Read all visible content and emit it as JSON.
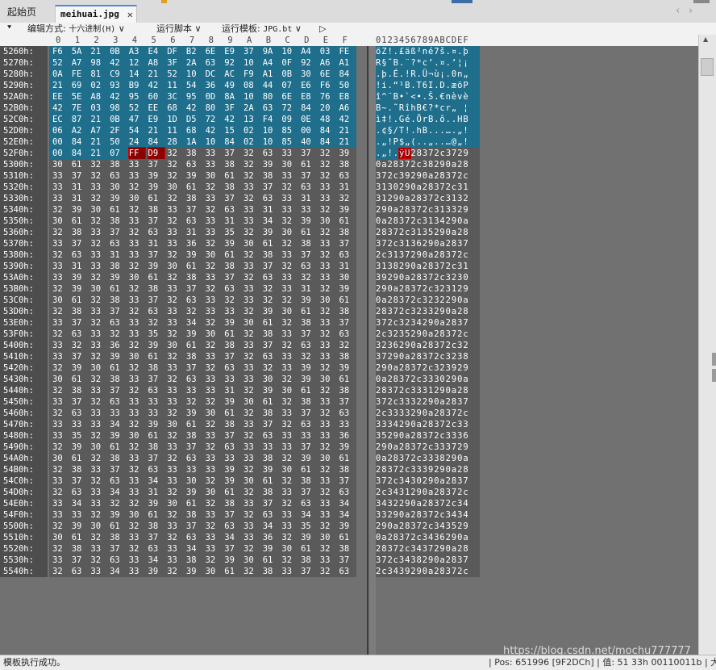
{
  "tabs": {
    "home_label": "起始页",
    "file_label": "meihuai.jpg",
    "close": "✕",
    "nav_left": "‹",
    "nav_right": "›"
  },
  "toolbar": {
    "arrow": "⯆",
    "edit_mode_label": "编辑方式:",
    "edit_mode_value": "十六进制(H)",
    "run_script_label": "运行脚本",
    "run_template_label": "运行模板:",
    "run_template_value": "JPG.bt",
    "chevron": "∨",
    "play": "▷"
  },
  "hex": {
    "columns": [
      "0",
      "1",
      "2",
      "3",
      "4",
      "5",
      "6",
      "7",
      "8",
      "9",
      "A",
      "B",
      "C",
      "D",
      "E",
      "F"
    ],
    "ascii_header": "0123456789ABCDEF",
    "rows": [
      {
        "addr": "5260h:",
        "bytes": "F6 5A 21 0B A3 E4 DF B2 6E E9 37 9A 10 A4 03 FE",
        "ascii": "öZ!.£äß²né7š.¤.þ",
        "sel": 16,
        "mark": []
      },
      {
        "addr": "5270h:",
        "bytes": "52 A7 98 42 12 A8 3F 2A 63 92 10 A4 0F 92 A6 A1",
        "ascii": "R§˜B.¨?*c’.¤.’¦¡",
        "sel": 16,
        "mark": []
      },
      {
        "addr": "5280h:",
        "bytes": "0A FE 81 C9 14 21 52 10 DC AC F9 A1 0B 30 6E 84",
        "ascii": ".þ.É.!R.Ü¬ù¡.0n„",
        "sel": 16,
        "mark": []
      },
      {
        "addr": "5290h:",
        "bytes": "21 69 02 93 B9 42 11 54 36 49 08 44 07 E6 F6 50",
        "ascii": "!i.“¹B.T6I.D.æöP",
        "sel": 16,
        "mark": []
      },
      {
        "addr": "52A0h:",
        "bytes": "EE 5E A8 42 95 60 3C 95 0D 8A 10 80 6E E8 76 E8",
        "ascii": "î^¨B•`<•.Š.€nèvè",
        "sel": 16,
        "mark": []
      },
      {
        "addr": "52B0h:",
        "bytes": "42 7E 03 98 52 EE 68 42 80 3F 2A 63 72 84 20 A6",
        "ascii": "B~.˜RîhB€?*cr„ ¦",
        "sel": 16,
        "mark": []
      },
      {
        "addr": "52C0h:",
        "bytes": "EC 87 21 0B 47 E9 1D D5 72 42 13 F4 09 0E 48 42",
        "ascii": "ì‡!.Gé.ÕrB.ô..HB",
        "sel": 16,
        "mark": []
      },
      {
        "addr": "52D0h:",
        "bytes": "06 A2 A7 2F 54 21 11 68 42 15 02 10 85 00 84 21",
        "ascii": ".¢§/T!.hB...….„!",
        "sel": 16,
        "mark": []
      },
      {
        "addr": "52E0h:",
        "bytes": "00 84 21 50 24 84 28 1A 10 84 02 10 85 40 84 21",
        "ascii": ".„!P$„(..„..…@„!",
        "sel": 16,
        "mark": []
      },
      {
        "addr": "52F0h:",
        "bytes": "00 84 21 07 FF D9 32 38 33 37 32 63 33 37 32 39",
        "ascii": ".„!.ÿÙ28372c3729",
        "sel": 4,
        "mark": [
          4,
          5
        ]
      },
      {
        "addr": "5300h:",
        "bytes": "30 61 32 38 33 37 32 63 33 38 32 39 30 61 32 38",
        "ascii": "0a28372c38290a28",
        "sel": 0,
        "mark": []
      },
      {
        "addr": "5310h:",
        "bytes": "33 37 32 63 33 39 32 39 30 61 32 38 33 37 32 63",
        "ascii": "372c39290a28372c",
        "sel": 0,
        "mark": []
      },
      {
        "addr": "5320h:",
        "bytes": "33 31 33 30 32 39 30 61 32 38 33 37 32 63 33 31",
        "ascii": "3130290a28372c31",
        "sel": 0,
        "mark": []
      },
      {
        "addr": "5330h:",
        "bytes": "33 31 32 39 30 61 32 38 33 37 32 63 33 31 33 32",
        "ascii": "31290a28372c3132",
        "sel": 0,
        "mark": []
      },
      {
        "addr": "5340h:",
        "bytes": "32 39 30 61 32 38 33 37 32 63 33 31 33 33 32 39",
        "ascii": "290a28372c313329",
        "sel": 0,
        "mark": []
      },
      {
        "addr": "5350h:",
        "bytes": "30 61 32 38 33 37 32 63 33 31 33 34 32 39 30 61",
        "ascii": "0a28372c3134290a",
        "sel": 0,
        "mark": []
      },
      {
        "addr": "5360h:",
        "bytes": "32 38 33 37 32 63 33 31 33 35 32 39 30 61 32 38",
        "ascii": "28372c3135290a28",
        "sel": 0,
        "mark": []
      },
      {
        "addr": "5370h:",
        "bytes": "33 37 32 63 33 31 33 36 32 39 30 61 32 38 33 37",
        "ascii": "372c3136290a2837",
        "sel": 0,
        "mark": []
      },
      {
        "addr": "5380h:",
        "bytes": "32 63 33 31 33 37 32 39 30 61 32 38 33 37 32 63",
        "ascii": "2c3137290a28372c",
        "sel": 0,
        "mark": []
      },
      {
        "addr": "5390h:",
        "bytes": "33 31 33 38 32 39 30 61 32 38 33 37 32 63 33 31",
        "ascii": "3138290a28372c31",
        "sel": 0,
        "mark": []
      },
      {
        "addr": "53A0h:",
        "bytes": "33 39 32 39 30 61 32 38 33 37 32 63 33 32 33 30",
        "ascii": "39290a28372c3230",
        "sel": 0,
        "mark": []
      },
      {
        "addr": "53B0h:",
        "bytes": "32 39 30 61 32 38 33 37 32 63 33 32 33 31 32 39",
        "ascii": "290a28372c323129",
        "sel": 0,
        "mark": []
      },
      {
        "addr": "53C0h:",
        "bytes": "30 61 32 38 33 37 32 63 33 32 33 32 32 39 30 61",
        "ascii": "0a28372c3232290a",
        "sel": 0,
        "mark": []
      },
      {
        "addr": "53D0h:",
        "bytes": "32 38 33 37 32 63 33 32 33 33 32 39 30 61 32 38",
        "ascii": "28372c3233290a28",
        "sel": 0,
        "mark": []
      },
      {
        "addr": "53E0h:",
        "bytes": "33 37 32 63 33 32 33 34 32 39 30 61 32 38 33 37",
        "ascii": "372c3234290a2837",
        "sel": 0,
        "mark": []
      },
      {
        "addr": "53F0h:",
        "bytes": "32 63 33 32 33 35 32 39 30 61 32 38 33 37 32 63",
        "ascii": "2c3235290a28372c",
        "sel": 0,
        "mark": []
      },
      {
        "addr": "5400h:",
        "bytes": "33 32 33 36 32 39 30 61 32 38 33 37 32 63 33 32",
        "ascii": "3236290a28372c32",
        "sel": 0,
        "mark": []
      },
      {
        "addr": "5410h:",
        "bytes": "33 37 32 39 30 61 32 38 33 37 32 63 33 32 33 38",
        "ascii": "37290a28372c3238",
        "sel": 0,
        "mark": []
      },
      {
        "addr": "5420h:",
        "bytes": "32 39 30 61 32 38 33 37 32 63 33 32 33 39 32 39",
        "ascii": "290a28372c323929",
        "sel": 0,
        "mark": []
      },
      {
        "addr": "5430h:",
        "bytes": "30 61 32 38 33 37 32 63 33 33 33 30 32 39 30 61",
        "ascii": "0a28372c3330290a",
        "sel": 0,
        "mark": []
      },
      {
        "addr": "5440h:",
        "bytes": "32 38 33 37 32 63 33 33 33 31 32 39 30 61 32 38",
        "ascii": "28372c3331290a28",
        "sel": 0,
        "mark": []
      },
      {
        "addr": "5450h:",
        "bytes": "33 37 32 63 33 33 33 32 32 39 30 61 32 38 33 37",
        "ascii": "372c3332290a2837",
        "sel": 0,
        "mark": []
      },
      {
        "addr": "5460h:",
        "bytes": "32 63 33 33 33 33 32 39 30 61 32 38 33 37 32 63",
        "ascii": "2c3333290a28372c",
        "sel": 0,
        "mark": []
      },
      {
        "addr": "5470h:",
        "bytes": "33 33 33 34 32 39 30 61 32 38 33 37 32 63 33 33",
        "ascii": "3334290a28372c33",
        "sel": 0,
        "mark": []
      },
      {
        "addr": "5480h:",
        "bytes": "33 35 32 39 30 61 32 38 33 37 32 63 33 33 33 36",
        "ascii": "35290a28372c3336",
        "sel": 0,
        "mark": []
      },
      {
        "addr": "5490h:",
        "bytes": "32 39 30 61 32 38 33 37 32 63 33 33 33 37 32 39",
        "ascii": "290a28372c333729",
        "sel": 0,
        "mark": []
      },
      {
        "addr": "54A0h:",
        "bytes": "30 61 32 38 33 37 32 63 33 33 33 38 32 39 30 61",
        "ascii": "0a28372c3338290a",
        "sel": 0,
        "mark": []
      },
      {
        "addr": "54B0h:",
        "bytes": "32 38 33 37 32 63 33 33 33 39 32 39 30 61 32 38",
        "ascii": "28372c3339290a28",
        "sel": 0,
        "mark": []
      },
      {
        "addr": "54C0h:",
        "bytes": "33 37 32 63 33 34 33 30 32 39 30 61 32 38 33 37",
        "ascii": "372c3430290a2837",
        "sel": 0,
        "mark": []
      },
      {
        "addr": "54D0h:",
        "bytes": "32 63 33 34 33 31 32 39 30 61 32 38 33 37 32 63",
        "ascii": "2c3431290a28372c",
        "sel": 0,
        "mark": []
      },
      {
        "addr": "54E0h:",
        "bytes": "33 34 33 32 32 39 30 61 32 38 33 37 32 63 33 34",
        "ascii": "3432290a28372c34",
        "sel": 0,
        "mark": []
      },
      {
        "addr": "54F0h:",
        "bytes": "33 33 32 39 30 61 32 38 33 37 32 63 33 34 33 34",
        "ascii": "33290a28372c3434",
        "sel": 0,
        "mark": []
      },
      {
        "addr": "5500h:",
        "bytes": "32 39 30 61 32 38 33 37 32 63 33 34 33 35 32 39",
        "ascii": "290a28372c343529",
        "sel": 0,
        "mark": []
      },
      {
        "addr": "5510h:",
        "bytes": "30 61 32 38 33 37 32 63 33 34 33 36 32 39 30 61",
        "ascii": "0a28372c3436290a",
        "sel": 0,
        "mark": []
      },
      {
        "addr": "5520h:",
        "bytes": "32 38 33 37 32 63 33 34 33 37 32 39 30 61 32 38",
        "ascii": "28372c3437290a28",
        "sel": 0,
        "mark": []
      },
      {
        "addr": "5530h:",
        "bytes": "33 37 32 63 33 34 33 38 32 39 30 61 32 38 33 37",
        "ascii": "372c3438290a2837",
        "sel": 0,
        "mark": []
      },
      {
        "addr": "5540h:",
        "bytes": "32 63 33 34 33 39 32 39 30 61 32 38 33 37 32 63",
        "ascii": "2c3439290a28372c",
        "sel": 0,
        "mark": []
      }
    ]
  },
  "status": {
    "left": "模板执行成功。",
    "right": "| Pos: 651996 [9F2DCh] | 值: 51 33h 00110011b | 大",
    "watermark": "https://blog.csdn.net/mochu777777"
  },
  "colors": {
    "selection": "#1f6e8c",
    "marker": "#8b0000",
    "grid_bg": "#717171"
  }
}
